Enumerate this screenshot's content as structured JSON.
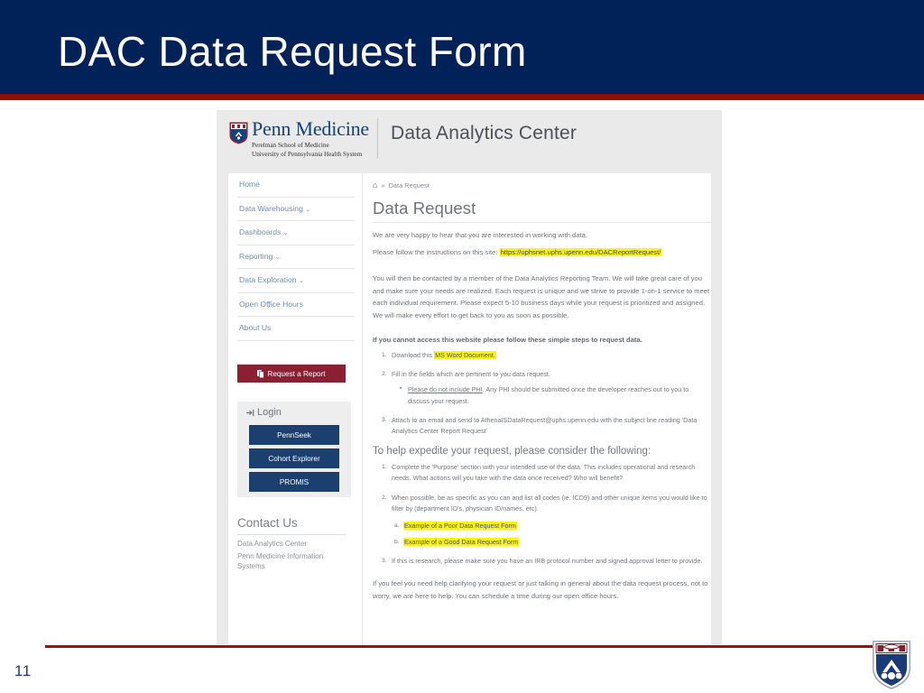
{
  "slide": {
    "title": "DAC Data Request Form",
    "page_number": "11",
    "navy": "#012159",
    "accent_red": "#8d0d0d"
  },
  "screenshot": {
    "site_header": {
      "logo_word": "Penn Medicine",
      "logo_sub_line1": "Perelman School of Medicine",
      "logo_sub_line2": "University of Pennsylvania Health System",
      "site_title": "Data Analytics Center",
      "logo_icon": "penn-shield-icon"
    },
    "sidebar": {
      "nav": [
        {
          "label": "Home",
          "caret": ""
        },
        {
          "label": "Data Warehousing",
          "caret": "⌄"
        },
        {
          "label": "Dashboards",
          "caret": "⌄"
        },
        {
          "label": "Reporting",
          "caret": "⌄"
        },
        {
          "label": "Data Exploration",
          "caret": "⌄"
        },
        {
          "label": "Open Office Hours",
          "caret": ""
        },
        {
          "label": "About Us",
          "caret": ""
        }
      ],
      "request_report_label": "Request a Report",
      "request_report_icon": "copy-document-icon",
      "request_report_color": "#8b2033",
      "login": {
        "title": "Login",
        "icon": "sign-in-icon",
        "buttons": [
          "PennSeek",
          "Cohort Explorer",
          "PROMIS"
        ],
        "button_color": "#1b3f6e"
      },
      "contact": {
        "title": "Contact Us",
        "lines": [
          "Data Analytics Center",
          "Penn Medicine Information Systems"
        ]
      }
    },
    "main": {
      "breadcrumb_home_icon": "home-icon",
      "breadcrumb_separator": "»",
      "breadcrumb_current": "Data Request",
      "heading": "Data Request",
      "para_0": "We are very happy to hear that you are interested in working with data.",
      "para_1_lead": "Please follow the instructions on this site:",
      "para_1_link": "https://uphsnet.uphs.upenn.edu/DACReportRequest/",
      "para_2": "You will then be contacted by a member of the Data Analytics Reporting Team.  We will take great care of you and make sure your needs are realized.  Each request is unique and we strive to provide 1-on-1 service to meet each individual requirement.  Please expect 5-10 business days while your request is prioritized and assigned.  We will make every effort to get back to you as soon as possible.",
      "para_3": "If you cannot access this website please follow these simple steps to request data.",
      "list_1": [
        {
          "num": "1.",
          "lead": "Download this",
          "highlight": "MS Word Document.",
          "tail": ""
        },
        {
          "num": "2.",
          "lead": "Fill in the fields which are pertinent to you data request.",
          "sub_bullet": "▪",
          "sub_underlined": "Please do not include PHI",
          "sub_tail": ". Any PHI should be submitted once the developer reaches out to you to discuss your request."
        },
        {
          "num": "3.",
          "lead": "Attach to an email and send to",
          "link": "AthenaISDataRequest@uphs.upenn.edu",
          "tail": "with the subject line reading 'Data Analytics Center Report Request'"
        }
      ],
      "subheading": "To help expedite your request, please consider the following:",
      "list_2": [
        {
          "num": "1.",
          "text": "Complete the 'Purpose' section with your intended use of the data.  This includes operational and research needs.  What actions will you take with the data once received?  Who will benefit?"
        },
        {
          "num": "2.",
          "text": "When possible, be as specific as you can and list all codes (ie. ICD9) and other unique items you would like to filter by (department ID's, physician ID/names, etc).",
          "alpha": [
            {
              "letter": "a.",
              "highlight": "Example of a Poor Data Request Form"
            },
            {
              "letter": "b.",
              "highlight": "Example of a Good Data Request Form"
            }
          ]
        },
        {
          "num": "3.",
          "text": "If this is research, please make sure you have an IRB protocol number and signed approval letter to provide."
        }
      ],
      "para_4_lead": "If you feel you need help clarifying your request or just talking in general about the data request process, not to worry, we are here to help. You can schedule a time during our",
      "para_4_link": "open office hours",
      "para_4_tail": "."
    }
  }
}
